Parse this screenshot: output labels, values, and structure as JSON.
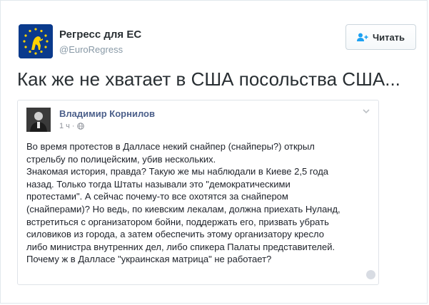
{
  "header": {
    "display_name": "Регресс для ЕС",
    "handle": "@EuroRegress",
    "follow_label": "Читать"
  },
  "tweet": {
    "text": "Как же не хватает в США посольства США..."
  },
  "quoted_post": {
    "author": "Владимир Корнилов",
    "time": "1 ч",
    "lines": [
      "Во время протестов в Далласе некий снайпер (снайперы?) открыл",
      "стрельбу по полицейским, убив нескольких.",
      "Знакомая история, правда? Такую же мы наблюдали в Киеве 2,5 года",
      "назад. Только тогда Штаты называли это \"демократическими",
      "протестами\". А сейчас почему-то все охотятся за снайпером",
      "(снайперами)? Но ведь, по киевским лекалам, должна приехать Нуланд,",
      "встретиться с организатором бойни, поддержать его, призвать убрать",
      "силовиков из города, а затем обеспечить этому организатору кресло",
      "либо министра внутренних дел, либо спикера Палаты представителей.",
      "Почему ж в Далласе \"украинская матрица\" не работает?"
    ]
  },
  "colors": {
    "avatar_bg": "#0a3a8c",
    "fb_name": "#4b5f8a",
    "twitter_text": "#292f33"
  }
}
